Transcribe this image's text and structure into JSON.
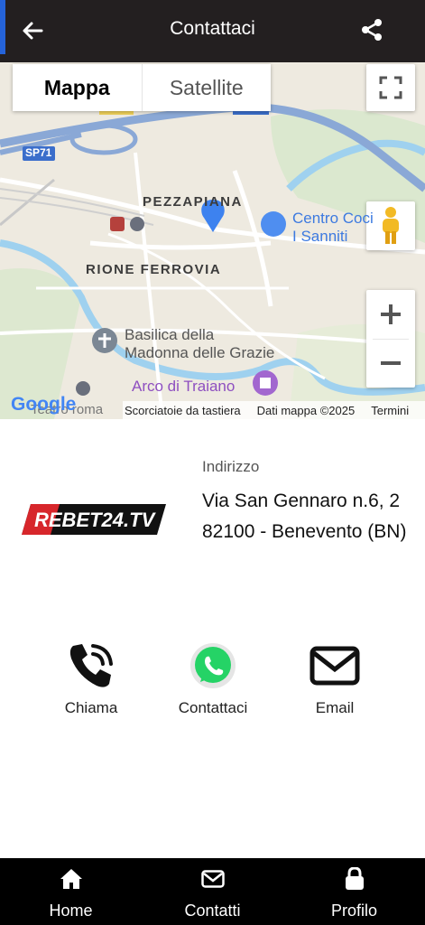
{
  "header": {
    "title": "Contattaci"
  },
  "map": {
    "type_buttons": {
      "map": "Mappa",
      "satellite": "Satellite"
    },
    "labels": {
      "pezzapiana": "PEZZAPIANA",
      "rione": "RIONE FERROVIA",
      "sp71": "SP71",
      "centro": "Centro Co",
      "centro_line2": "ci",
      "sanniti": "I Sanniti",
      "basilica1": "Basilica della",
      "basilica2": "Madonna delle Grazie",
      "arco": "Arco di Traiano",
      "teatro": "Teatro roma"
    },
    "attribution": {
      "logo": "Google",
      "shortcuts": "Scorciatoie da tastiera",
      "data": "Dati mappa ©2025",
      "terms": "Termini"
    }
  },
  "info": {
    "logo_text": "REBET24.TV",
    "address_label": "Indirizzo",
    "address": "Via San Gennaro n.6, 2 82100 - Benevento (BN)"
  },
  "actions": [
    {
      "label": "Chiama"
    },
    {
      "label": "Contattaci"
    },
    {
      "label": "Email"
    }
  ],
  "nav": [
    {
      "label": "Home"
    },
    {
      "label": "Contatti"
    },
    {
      "label": "Profilo"
    }
  ],
  "colors": {
    "header_bg": "#231f20",
    "accent": "#2563d9",
    "whatsapp": "#25d366",
    "logo_red": "#d7262b",
    "nav_bg": "#000000"
  }
}
